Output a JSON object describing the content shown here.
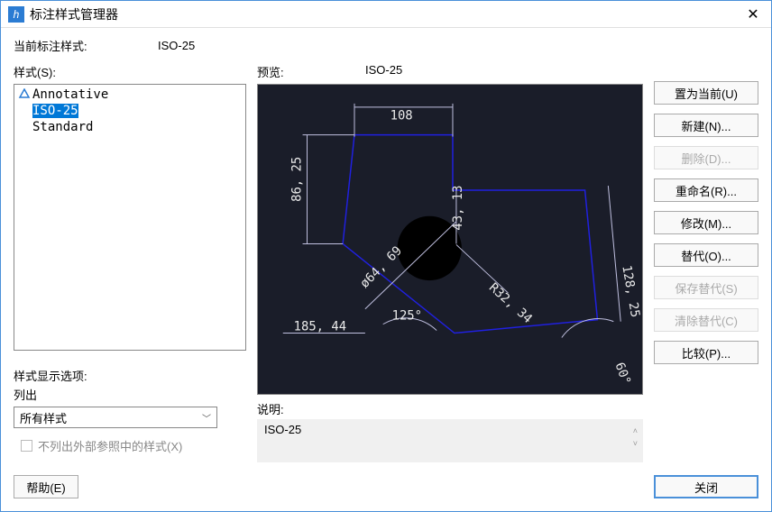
{
  "titlebar": {
    "title": "标注样式管理器"
  },
  "current": {
    "label": "当前标注样式:",
    "value": "ISO-25"
  },
  "styles": {
    "label": "样式(S):",
    "items": [
      "Annotative",
      "ISO-25",
      "Standard"
    ],
    "selected_index": 1,
    "annotative_index": 0
  },
  "display_options": {
    "label": "样式显示选项:",
    "sub_label": "列出",
    "combo_value": "所有样式",
    "checkbox_label": "不列出外部参照中的样式(X)"
  },
  "preview": {
    "label": "预览:",
    "value": "ISO-25",
    "dims": {
      "d1": "108",
      "d2": "86, 25",
      "d3": "43, 13",
      "d4": "128, 25",
      "d5": "ø64, 69",
      "d6": "R32, 34",
      "d7": "125°",
      "d8": "185, 44",
      "d9": "60°"
    }
  },
  "description": {
    "label": "说明:",
    "value": "ISO-25"
  },
  "buttons": {
    "set_current": "置为当前(U)",
    "new": "新建(N)...",
    "delete": "删除(D)...",
    "rename": "重命名(R)...",
    "modify": "修改(M)...",
    "override": "替代(O)...",
    "save_override": "保存替代(S)",
    "clear_override": "清除替代(C)",
    "compare": "比较(P)..."
  },
  "bottom": {
    "help": "帮助(E)",
    "close": "关闭"
  }
}
